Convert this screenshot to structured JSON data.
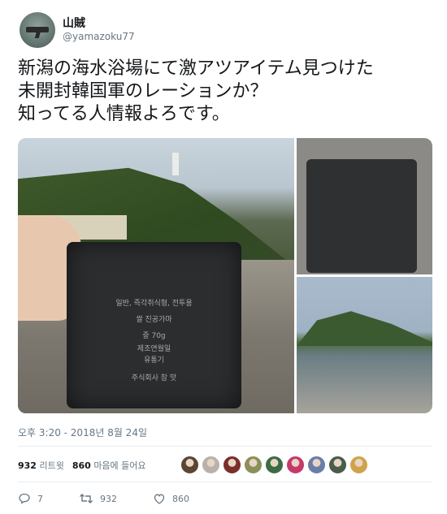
{
  "user": {
    "display_name": "山賊",
    "handle": "@yamazoku77"
  },
  "tweet": {
    "lines": [
      "新潟の海水浴場にて激アツアイテム見つけた",
      "未開封韓国軍のレーションか？",
      "知ってる人情報よろです。"
    ],
    "timestamp": "오후 3:20 - 2018년 8월 24일"
  },
  "photo": {
    "packet_lines": [
      "일반, 즉각취식형, 전투용",
      "쌀 진공가마",
      "중 70g",
      "제조연월일",
      "유통기",
      "주식회사 참 맛"
    ]
  },
  "stats": {
    "retweets_count": "932",
    "retweets_label": "리트윗",
    "likes_count": "860",
    "likes_label": "마음에 들어요"
  },
  "likers": [
    {
      "color": "#5a4632"
    },
    {
      "color": "#b8b2aa"
    },
    {
      "color": "#7a2f2a"
    },
    {
      "color": "#8b8f5a"
    },
    {
      "color": "#3d6b44"
    },
    {
      "color": "#c53a6a"
    },
    {
      "color": "#6a7ea8"
    },
    {
      "color": "#4a5c4a"
    },
    {
      "color": "#d0a24c"
    }
  ],
  "actions": {
    "reply_count": "7",
    "retweet_count": "932",
    "like_count": "860"
  },
  "colors": {
    "text": "#14171a",
    "secondary": "#657786",
    "divider": "#e6ecf0"
  }
}
